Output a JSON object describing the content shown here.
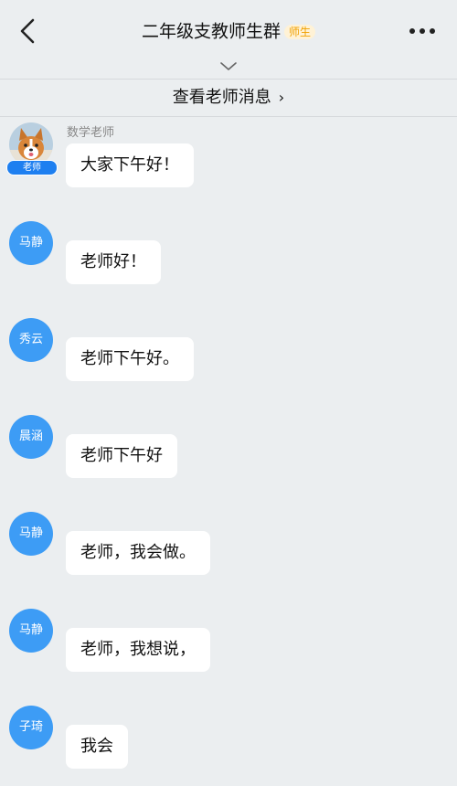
{
  "header": {
    "title": "二年级支教师生群",
    "badge": "师生",
    "back_icon": "chevron-left-icon",
    "more_icon": "more-horizontal-icon",
    "expand_icon": "chevron-down-icon"
  },
  "teacher_bar": {
    "label": "查看老师消息",
    "arrow": "›"
  },
  "colors": {
    "background": "#ebeef0",
    "avatar_blue": "#3d9cf5",
    "role_tag_blue": "#1e7ff0",
    "badge_orange": "#f0a000",
    "badge_bg": "#fff2d6"
  },
  "messages": [
    {
      "avatar": "",
      "avatar_type": "photo",
      "role_tag": "老师",
      "sender": "数学老师",
      "text": "大家下午好！"
    },
    {
      "avatar": "马静",
      "text": "老师好！"
    },
    {
      "avatar": "秀云",
      "text": "老师下午好。"
    },
    {
      "avatar": "晨涵",
      "text": "老师下午好"
    },
    {
      "avatar": "马静",
      "text": "老师，我会做。"
    },
    {
      "avatar": "马静",
      "text": "老师，我想说，"
    },
    {
      "avatar": "子琦",
      "text": "我会"
    }
  ]
}
